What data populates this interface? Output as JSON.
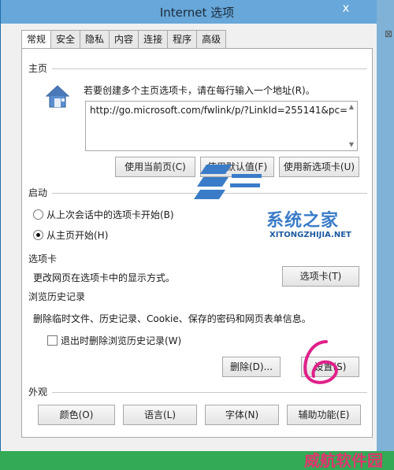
{
  "window": {
    "title": "Internet 选项",
    "close_glyph": "x"
  },
  "tabs": [
    "常规",
    "安全",
    "隐私",
    "内容",
    "连接",
    "程序",
    "高级"
  ],
  "home": {
    "section_label": "主页",
    "hint": "若要创建多个主页选项卡，请在每行输入一个地址(R)。",
    "url": "http://go.microsoft.com/fwlink/p/?LinkId=255141&pc=",
    "buttons": {
      "use_current": "使用当前页(C)",
      "use_default": "使用默认值(F)",
      "use_new_tab": "使用新选项卡(U)"
    }
  },
  "startup": {
    "section_label": "启动",
    "option_last_session": "从上次会话中的选项卡开始(B)",
    "option_home": "从主页开始(H)",
    "selected": "option_home"
  },
  "tabs_section": {
    "section_label": "选项卡",
    "description": "更改网页在选项卡中的显示方式。",
    "button": "选项卡(T)"
  },
  "history": {
    "section_label": "浏览历史记录",
    "description": "删除临时文件、历史记录、Cookie、保存的密码和网页表单信息。",
    "checkbox_label": "退出时删除浏览历史记录(W)",
    "checkbox_checked": false,
    "delete_button": "删除(D)...",
    "settings_button": "设置(S)"
  },
  "appearance": {
    "section_label": "外观",
    "colors_button": "颜色(O)",
    "language_button": "语言(L)",
    "fonts_button": "字体(N)",
    "accessibility_button": "辅助功能(E)"
  },
  "watermark": {
    "site_name": "系统之家",
    "site_url": "XITONGZHIJIA.NET"
  },
  "annotation": {
    "mark": "6"
  },
  "footer": {
    "brand": "威航软件园"
  },
  "colors": {
    "title_bar": "#67a7d9",
    "footer": "#33aa55",
    "brand_text": "#e0356e",
    "annotation": "#e0208a",
    "watermark_blue": "#3a7cc8"
  }
}
